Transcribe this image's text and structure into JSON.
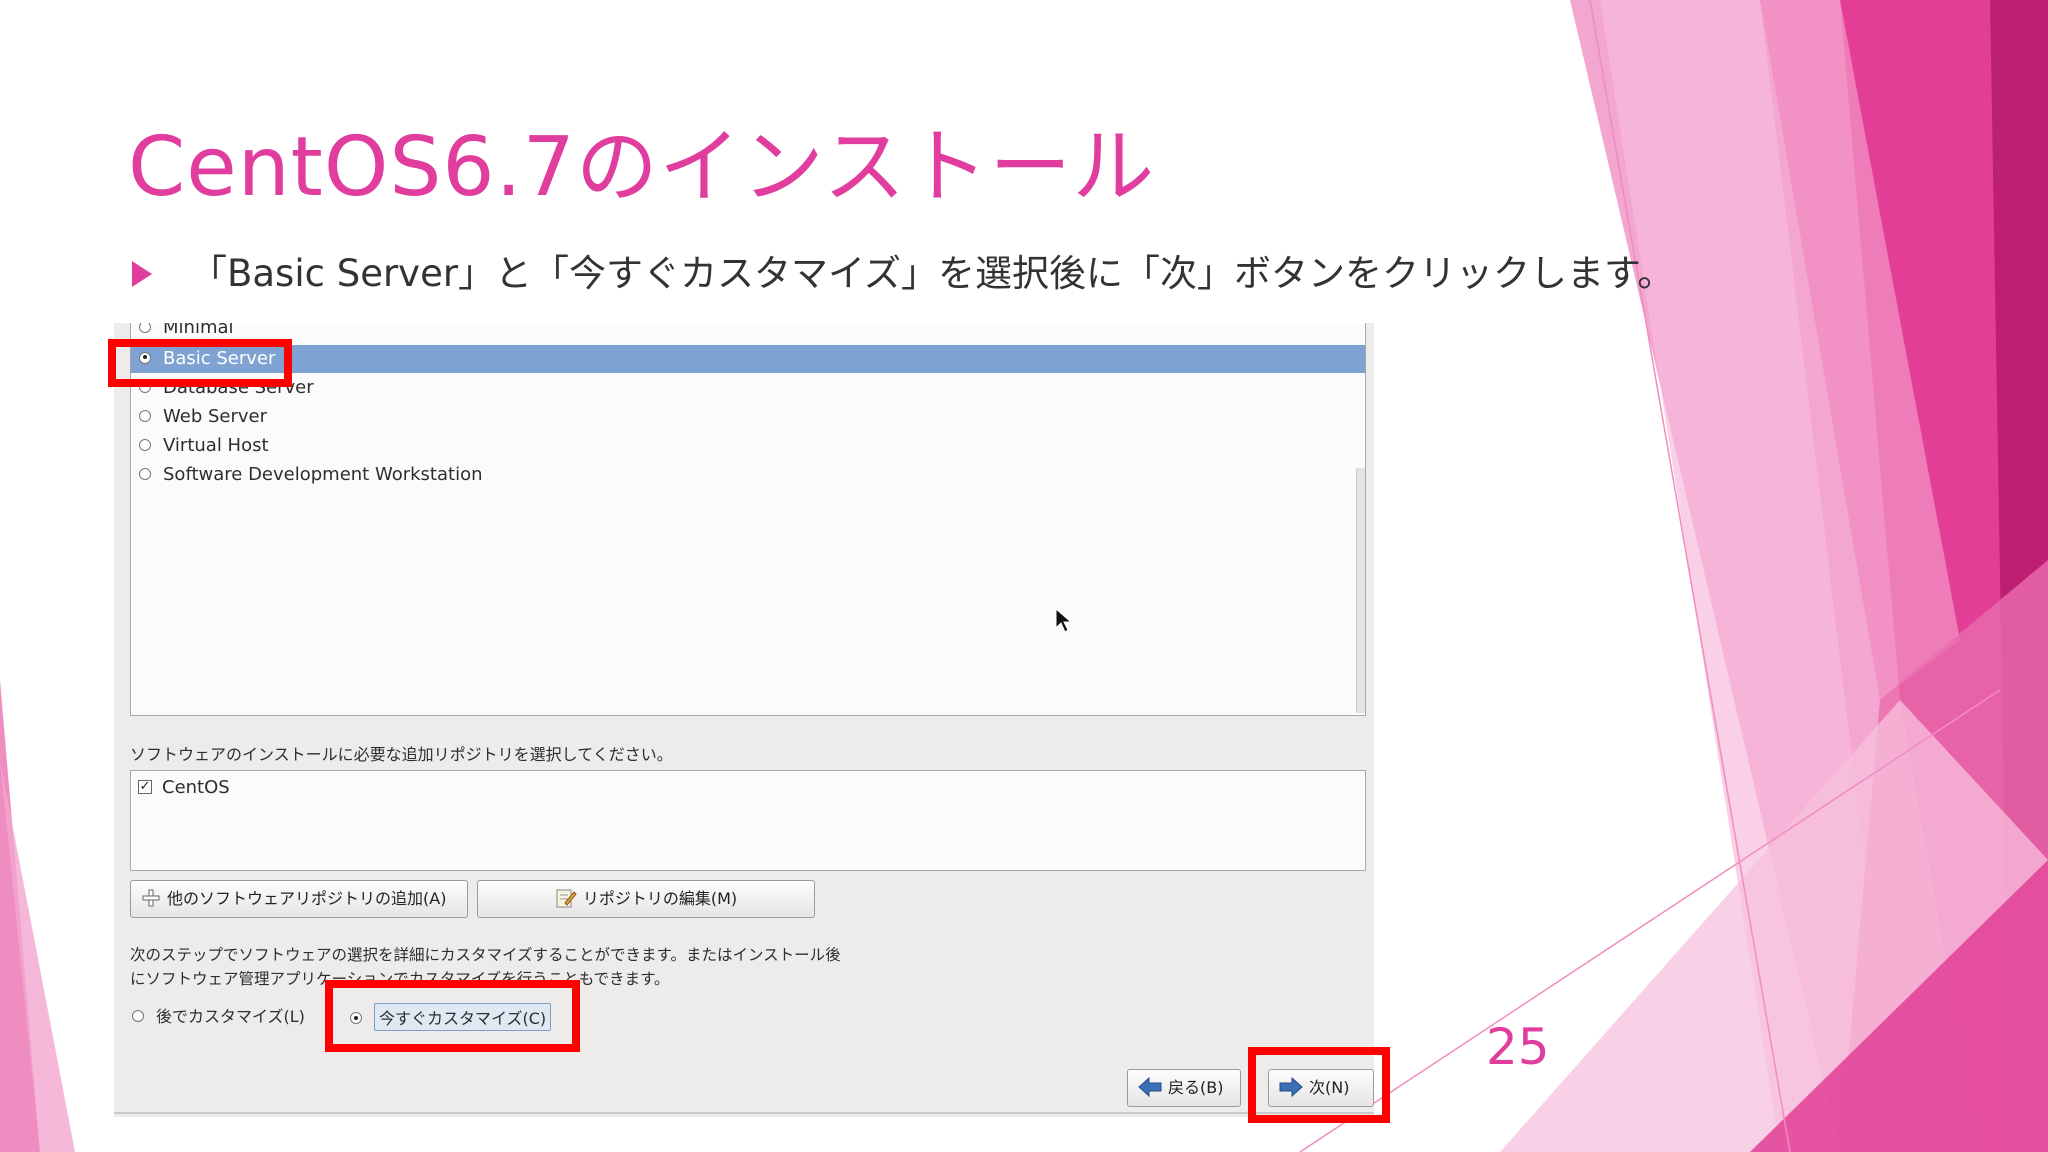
{
  "slide": {
    "title": "CentOS6.7のインストール",
    "bullet": "「Basic Server」と「今すぐカスタマイズ」を選択後に「次」ボタンをクリックします。",
    "page_number": "25"
  },
  "installer": {
    "server_types": [
      {
        "label": "Minimal",
        "selected": false
      },
      {
        "label": "Basic Server",
        "selected": true
      },
      {
        "label": "Database Server",
        "selected": false
      },
      {
        "label": "Web Server",
        "selected": false
      },
      {
        "label": "Virtual Host",
        "selected": false
      },
      {
        "label": "Software Development Workstation",
        "selected": false
      }
    ],
    "repo_prompt": "ソフトウェアのインストールに必要な追加リポジトリを選択してください。",
    "repos": [
      {
        "label": "CentOS",
        "checked": true,
        "mark": "✓"
      }
    ],
    "add_repo_button": "他のソフトウェアリポジトリの追加(A)",
    "edit_repo_button": "リポジトリの編集(M)",
    "customize_description_line1": "次のステップでソフトウェアの選択を詳細にカスタマイズすることができます。またはインストール後",
    "customize_description_line2": "にソフトウェア管理アプリケーションでカスタマイズを行うこともできます。",
    "customize_later": "後でカスタマイズ(L)",
    "customize_now": "今すぐカスタマイズ(C)",
    "back_button": "戻る(B)",
    "next_button": "次(N)"
  },
  "colors": {
    "accent": "#e03d9f",
    "highlight_red": "#ff0000",
    "selection": "#7ea3d2"
  }
}
